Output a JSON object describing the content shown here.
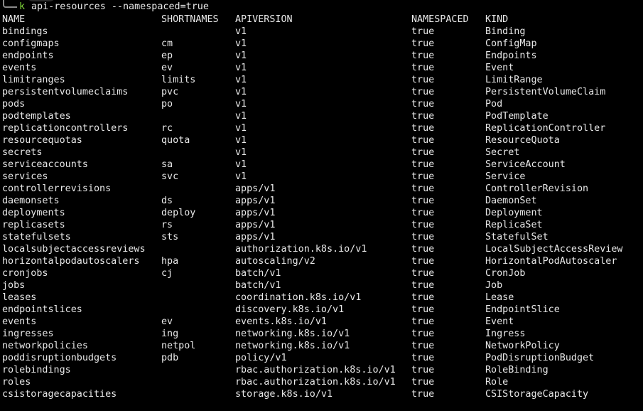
{
  "prompt": {
    "symbol": "k",
    "command": "api-resources --namespaced=true",
    "symbol_color": "#7fd63a"
  },
  "table": {
    "headers": {
      "name": "NAME",
      "shortnames": "SHORTNAMES",
      "apiversion": "APIVERSION",
      "namespaced": "NAMESPACED",
      "kind": "KIND"
    },
    "rows": [
      {
        "name": "bindings",
        "shortnames": "",
        "apiversion": "v1",
        "namespaced": "true",
        "kind": "Binding"
      },
      {
        "name": "configmaps",
        "shortnames": "cm",
        "apiversion": "v1",
        "namespaced": "true",
        "kind": "ConfigMap"
      },
      {
        "name": "endpoints",
        "shortnames": "ep",
        "apiversion": "v1",
        "namespaced": "true",
        "kind": "Endpoints"
      },
      {
        "name": "events",
        "shortnames": "ev",
        "apiversion": "v1",
        "namespaced": "true",
        "kind": "Event"
      },
      {
        "name": "limitranges",
        "shortnames": "limits",
        "apiversion": "v1",
        "namespaced": "true",
        "kind": "LimitRange"
      },
      {
        "name": "persistentvolumeclaims",
        "shortnames": "pvc",
        "apiversion": "v1",
        "namespaced": "true",
        "kind": "PersistentVolumeClaim"
      },
      {
        "name": "pods",
        "shortnames": "po",
        "apiversion": "v1",
        "namespaced": "true",
        "kind": "Pod"
      },
      {
        "name": "podtemplates",
        "shortnames": "",
        "apiversion": "v1",
        "namespaced": "true",
        "kind": "PodTemplate"
      },
      {
        "name": "replicationcontrollers",
        "shortnames": "rc",
        "apiversion": "v1",
        "namespaced": "true",
        "kind": "ReplicationController"
      },
      {
        "name": "resourcequotas",
        "shortnames": "quota",
        "apiversion": "v1",
        "namespaced": "true",
        "kind": "ResourceQuota"
      },
      {
        "name": "secrets",
        "shortnames": "",
        "apiversion": "v1",
        "namespaced": "true",
        "kind": "Secret"
      },
      {
        "name": "serviceaccounts",
        "shortnames": "sa",
        "apiversion": "v1",
        "namespaced": "true",
        "kind": "ServiceAccount"
      },
      {
        "name": "services",
        "shortnames": "svc",
        "apiversion": "v1",
        "namespaced": "true",
        "kind": "Service"
      },
      {
        "name": "controllerrevisions",
        "shortnames": "",
        "apiversion": "apps/v1",
        "namespaced": "true",
        "kind": "ControllerRevision"
      },
      {
        "name": "daemonsets",
        "shortnames": "ds",
        "apiversion": "apps/v1",
        "namespaced": "true",
        "kind": "DaemonSet"
      },
      {
        "name": "deployments",
        "shortnames": "deploy",
        "apiversion": "apps/v1",
        "namespaced": "true",
        "kind": "Deployment"
      },
      {
        "name": "replicasets",
        "shortnames": "rs",
        "apiversion": "apps/v1",
        "namespaced": "true",
        "kind": "ReplicaSet"
      },
      {
        "name": "statefulsets",
        "shortnames": "sts",
        "apiversion": "apps/v1",
        "namespaced": "true",
        "kind": "StatefulSet"
      },
      {
        "name": "localsubjectaccessreviews",
        "shortnames": "",
        "apiversion": "authorization.k8s.io/v1",
        "namespaced": "true",
        "kind": "LocalSubjectAccessReview"
      },
      {
        "name": "horizontalpodautoscalers",
        "shortnames": "hpa",
        "apiversion": "autoscaling/v2",
        "namespaced": "true",
        "kind": "HorizontalPodAutoscaler"
      },
      {
        "name": "cronjobs",
        "shortnames": "cj",
        "apiversion": "batch/v1",
        "namespaced": "true",
        "kind": "CronJob"
      },
      {
        "name": "jobs",
        "shortnames": "",
        "apiversion": "batch/v1",
        "namespaced": "true",
        "kind": "Job"
      },
      {
        "name": "leases",
        "shortnames": "",
        "apiversion": "coordination.k8s.io/v1",
        "namespaced": "true",
        "kind": "Lease"
      },
      {
        "name": "endpointslices",
        "shortnames": "",
        "apiversion": "discovery.k8s.io/v1",
        "namespaced": "true",
        "kind": "EndpointSlice"
      },
      {
        "name": "events",
        "shortnames": "ev",
        "apiversion": "events.k8s.io/v1",
        "namespaced": "true",
        "kind": "Event"
      },
      {
        "name": "ingresses",
        "shortnames": "ing",
        "apiversion": "networking.k8s.io/v1",
        "namespaced": "true",
        "kind": "Ingress"
      },
      {
        "name": "networkpolicies",
        "shortnames": "netpol",
        "apiversion": "networking.k8s.io/v1",
        "namespaced": "true",
        "kind": "NetworkPolicy"
      },
      {
        "name": "poddisruptionbudgets",
        "shortnames": "pdb",
        "apiversion": "policy/v1",
        "namespaced": "true",
        "kind": "PodDisruptionBudget"
      },
      {
        "name": "rolebindings",
        "shortnames": "",
        "apiversion": "rbac.authorization.k8s.io/v1",
        "namespaced": "true",
        "kind": "RoleBinding"
      },
      {
        "name": "roles",
        "shortnames": "",
        "apiversion": "rbac.authorization.k8s.io/v1",
        "namespaced": "true",
        "kind": "Role"
      },
      {
        "name": "csistoragecapacities",
        "shortnames": "",
        "apiversion": "storage.k8s.io/v1",
        "namespaced": "true",
        "kind": "CSIStorageCapacity"
      }
    ]
  }
}
